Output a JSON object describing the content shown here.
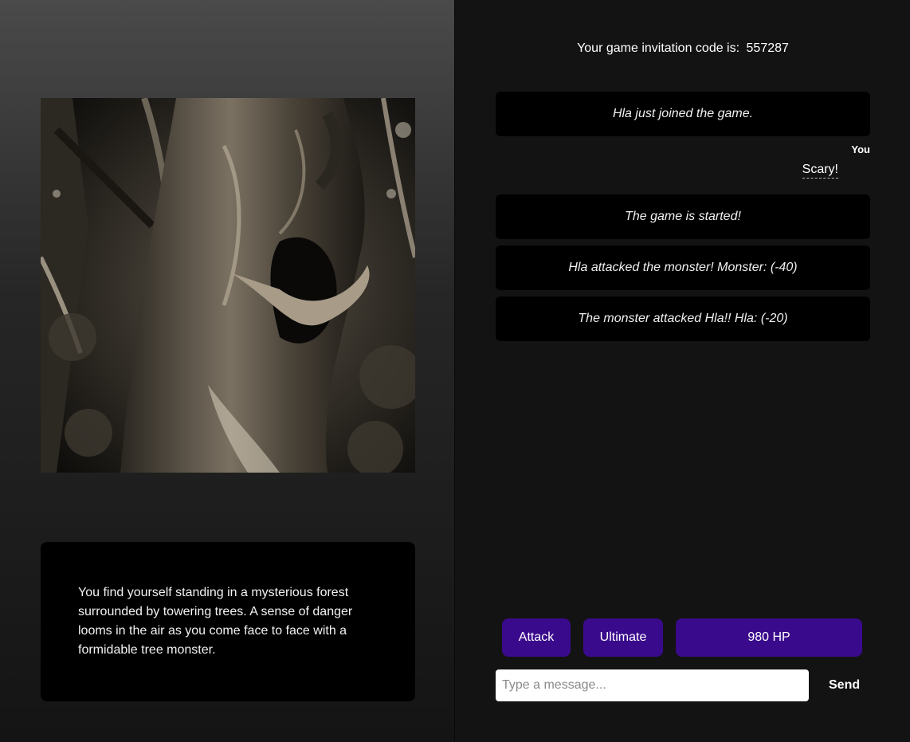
{
  "scene": {
    "image_alt": "Tree monster in a dark forest",
    "story": "You find yourself standing in a mysterious forest surrounded by towering trees. A sense of danger looms in the air as you come face to face with a formidable tree monster."
  },
  "header": {
    "invite_label": "Your game invitation code is:",
    "invite_code": "557287"
  },
  "chat": {
    "system_messages": [
      "Hla just joined the game.",
      "The game is started!",
      "Hla attacked the monster! Monster: (-40)",
      "The monster attacked Hla!! Hla: (-20)"
    ],
    "user_message": {
      "author": "You",
      "text": "Scary!"
    }
  },
  "actions": {
    "attack_label": "Attack",
    "ultimate_label": "Ultimate",
    "hp": "980 HP"
  },
  "composer": {
    "placeholder": "Type a message...",
    "send_label": "Send"
  },
  "colors": {
    "accent": "#3a0a8c",
    "panel": "#000000",
    "background": "#131313"
  }
}
